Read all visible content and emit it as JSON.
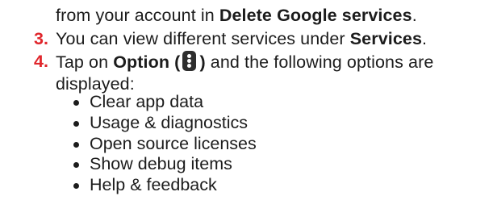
{
  "accent_color": "#e0262c",
  "text_color": "#1c1c1c",
  "step2_continuation": {
    "text_before": "from your account in ",
    "bold_term": "Delete Google services",
    "text_after": "."
  },
  "step3": {
    "number": "3.",
    "text_before": "You can view different services under ",
    "bold_term": "Services",
    "text_after": "."
  },
  "step4": {
    "number": "4.",
    "text_before": "Tap on ",
    "bold_open": "Option (",
    "icon": "more-vertical-icon",
    "bold_close": ")",
    "text_after": " and the following options are",
    "text_line2": "displayed:"
  },
  "options": [
    "Clear app data",
    "Usage & diagnostics",
    "Open source licenses",
    "Show debug items",
    "Help & feedback"
  ]
}
